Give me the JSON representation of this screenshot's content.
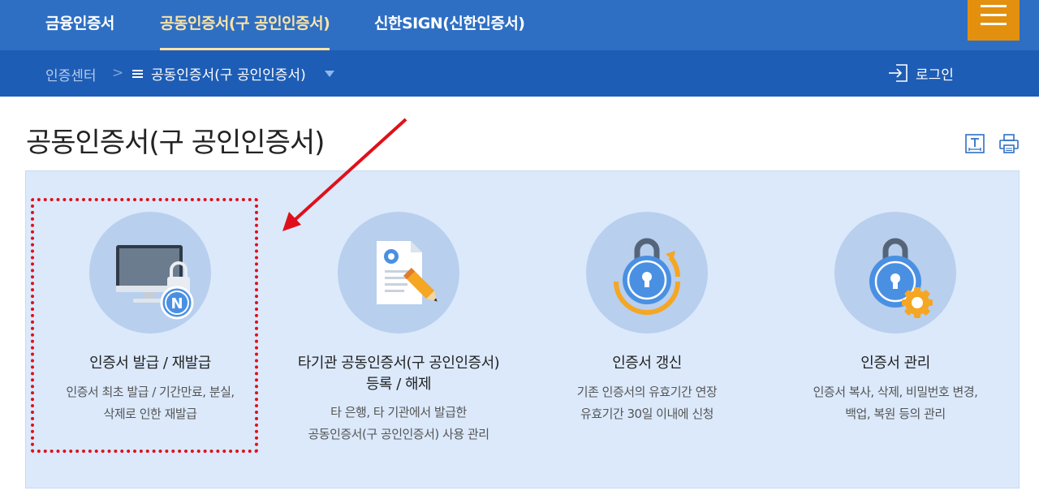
{
  "top_nav": {
    "tabs": [
      {
        "label": "금융인증서"
      },
      {
        "label": "공동인증서(구 공인인증서)"
      },
      {
        "label": "신한SIGN(신한인증서)"
      }
    ]
  },
  "breadcrumb": {
    "home": "인증센터",
    "separator": ">",
    "current": "공동인증서(구 공인인증서)"
  },
  "login_label": "로그인",
  "page_title": "공동인증서(구 공인인증서)",
  "cards": [
    {
      "icon": "monitor-lock-icon",
      "title": "인증서 발급 / 재발급",
      "desc_line1": "인증서 최초 발급 / 기간만료, 분실,",
      "desc_line2": "삭제로 인한 재발급"
    },
    {
      "icon": "document-pen-icon",
      "title_line1": "타기관 공동인증서(구 공인인증서)",
      "title_line2": "등록 / 해제",
      "desc_line1": "타 은행, 타 기관에서 발급한",
      "desc_line2": "공동인증서(구 공인인증서) 사용 관리"
    },
    {
      "icon": "lock-renew-icon",
      "title": "인증서 갱신",
      "desc_line1": "기존 인증서의 유효기간 연장",
      "desc_line2": "유효기간 30일 이내에 신청"
    },
    {
      "icon": "lock-gear-icon",
      "title": "인증서 관리",
      "desc_line1": "인증서 복사, 삭제, 비밀번호 변경,",
      "desc_line2": "백업, 복원 등의 관리"
    }
  ],
  "colors": {
    "top_nav_bg": "#2e6fc4",
    "sub_nav_bg": "#1e5db5",
    "active_tab": "#fbe3a6",
    "menu_button": "#e3900f",
    "panel_bg": "#dbe9fb",
    "icon_circle": "#b8cfee",
    "highlight_red": "#e0101a"
  }
}
